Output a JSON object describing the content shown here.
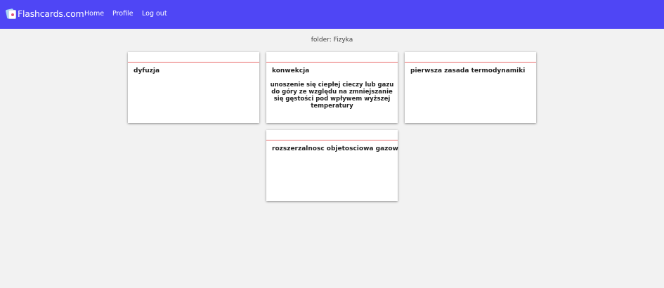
{
  "nav": {
    "brand": "Flashcards.com",
    "brand_icon": "flashcards-logo-icon",
    "links": [
      {
        "label": "Home"
      },
      {
        "label": "Profile"
      },
      {
        "label": "Log out"
      }
    ]
  },
  "colors": {
    "navbar": "#4f46f5",
    "card_divider": "#e96a6a",
    "background": "#f2f2f2"
  },
  "folder": {
    "title": "folder: Fizyka"
  },
  "cards": [
    {
      "term": "dyfuzja",
      "definition": ""
    },
    {
      "term": "konwekcja",
      "definition": "unoszenie się ciepłej cieczy lub gazu do góry ze względu na zmniejszanie się gęstości pod wpływem wyższej temperatury"
    },
    {
      "term": "pierwsza zasada termodynamiki",
      "definition": ""
    },
    {
      "term": "rozszerzalnosc objetosciowa gazow",
      "definition": ""
    }
  ]
}
